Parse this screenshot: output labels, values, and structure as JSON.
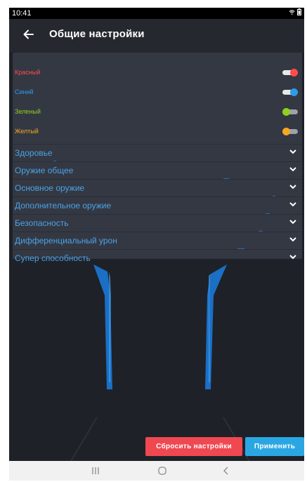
{
  "status_bar": {
    "time": "10:41",
    "icons": [
      "wifi-icon",
      "battery-icon"
    ]
  },
  "header": {
    "title": "Общие настройки",
    "back_icon": "arrow-back-icon"
  },
  "colors": [
    {
      "label": "Красный",
      "color": "#ff4c4c",
      "enabled": true
    },
    {
      "label": "Синий",
      "color": "#2e9be6",
      "enabled": true
    },
    {
      "label": "Зеленый",
      "color": "#8fd11e",
      "enabled": false
    },
    {
      "label": "Желтый",
      "color": "#f7a823",
      "enabled": false
    }
  ],
  "sections": [
    {
      "label": "Здоровье"
    },
    {
      "label": "Оружие общее"
    },
    {
      "label": "Основное оружие"
    },
    {
      "label": "Дополнительное оружие"
    },
    {
      "label": "Безопасность"
    },
    {
      "label": "Дифференциальный урон"
    },
    {
      "label": "Супер способность"
    }
  ],
  "buttons": {
    "reset": "Сбросить настройки",
    "apply": "Применить"
  },
  "theme": {
    "accent": "#4aa3e6",
    "reset": "#ef4851",
    "apply": "#2aa7e3",
    "panel": "#343843",
    "background": "#1e2128"
  },
  "nav_bar": {
    "icons": [
      "recents-icon",
      "home-icon",
      "back-icon"
    ]
  }
}
